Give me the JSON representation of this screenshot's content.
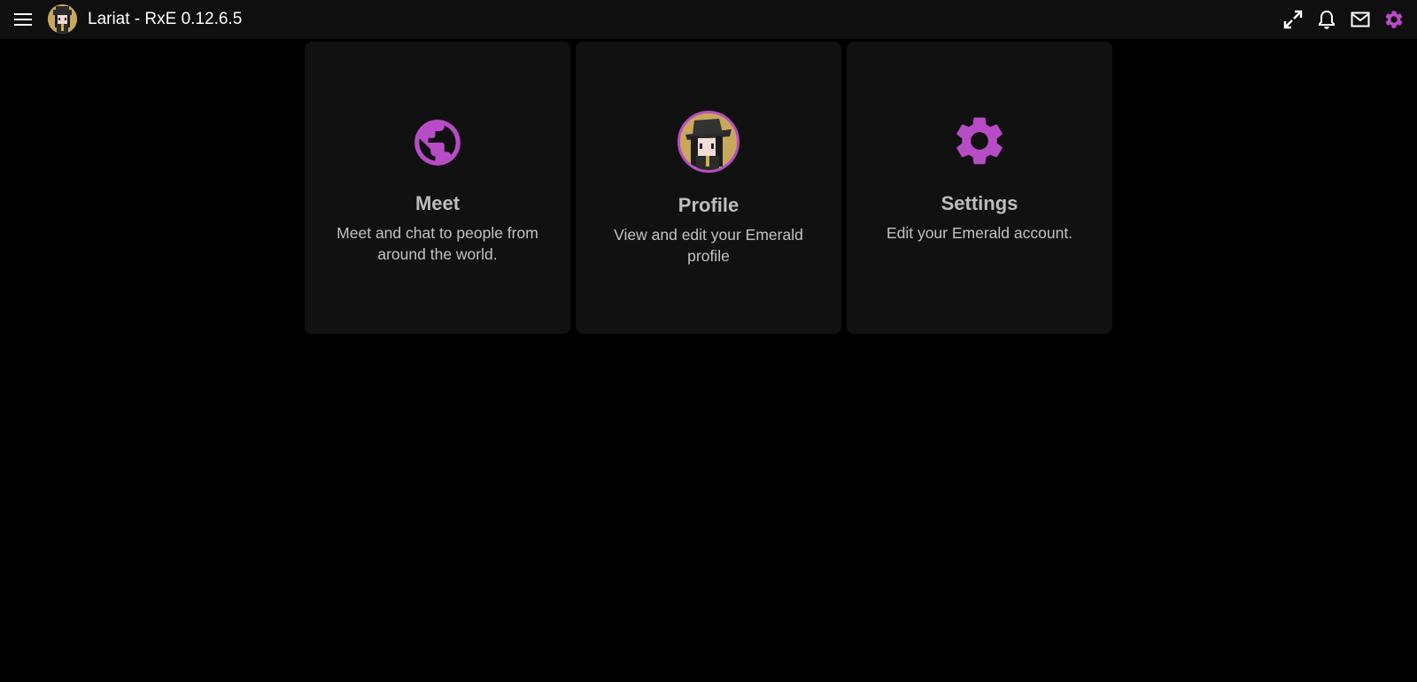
{
  "app": {
    "title": "Lariat - RxE 0.12.6.5"
  },
  "topbar": {
    "icons": [
      "menu-icon",
      "avatar",
      "fullscreen-icon",
      "bell-icon",
      "mail-icon",
      "gear-icon"
    ]
  },
  "colors": {
    "accent": "#b84cc6",
    "background": "#000000",
    "topbar": "#0f0f0f",
    "card": "#111111",
    "text_primary": "#bdbdbd",
    "text_secondary": "#c2c2c2"
  },
  "cards": [
    {
      "title": "Meet",
      "description": "Meet and chat to people from around the world.",
      "icon": "globe-icon"
    },
    {
      "title": "Profile",
      "description": "View and edit your Emerald profile",
      "icon": "profile-avatar"
    },
    {
      "title": "Settings",
      "description": "Edit your Emerald account.",
      "icon": "gear-icon"
    }
  ]
}
